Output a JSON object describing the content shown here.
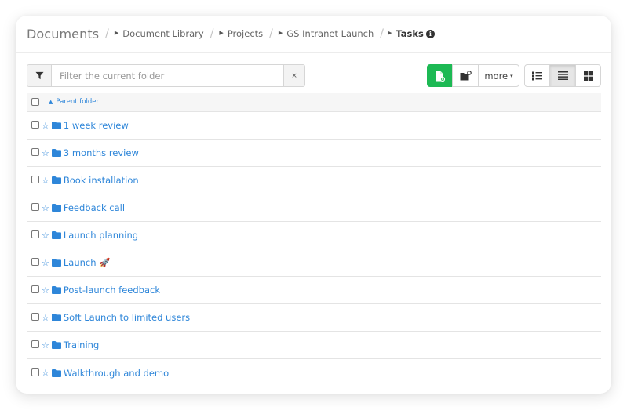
{
  "breadcrumb": {
    "root": "Documents",
    "separator": "/",
    "items": [
      "Document Library",
      "Projects",
      "GS Intranet Launch"
    ],
    "current": "Tasks",
    "info_icon": "info-circle-icon"
  },
  "toolbar": {
    "filter": {
      "icon": "filter-icon",
      "placeholder": "Filter the current folder",
      "value": "",
      "clear_label": "×"
    },
    "actions": {
      "new_file_icon": "new-file-icon",
      "new_folder_icon": "new-folder-icon",
      "more_label": "more",
      "more_caret": "▾"
    },
    "views": {
      "detail_list_icon": "list-details-icon",
      "list_icon": "list-icon",
      "grid_icon": "grid-icon",
      "active": "list"
    }
  },
  "list": {
    "parent_folder_label": "Parent folder",
    "parent_icon": "chevron-up-icon",
    "items": [
      {
        "name": "1 week review",
        "starred": false
      },
      {
        "name": "3 months review",
        "starred": false
      },
      {
        "name": "Book installation",
        "starred": false
      },
      {
        "name": "Feedback call",
        "starred": false
      },
      {
        "name": "Launch planning",
        "starred": false
      },
      {
        "name": "Launch 🚀",
        "starred": false
      },
      {
        "name": "Post-launch feedback",
        "starred": false
      },
      {
        "name": "Soft Launch to limited users",
        "starred": false
      },
      {
        "name": "Training",
        "starred": false
      },
      {
        "name": "Walkthrough and demo",
        "starred": false
      }
    ]
  },
  "colors": {
    "link": "#2e86d9",
    "primary": "#1db954"
  }
}
